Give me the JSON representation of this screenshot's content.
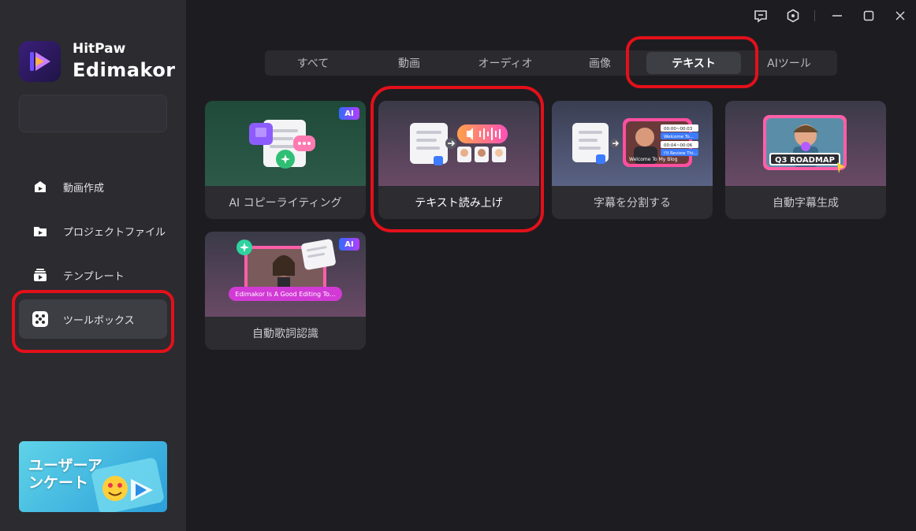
{
  "brand": {
    "line1": "HitPaw",
    "line2": "Edimakor"
  },
  "sidebar": {
    "items": [
      {
        "label": "動画作成",
        "icon": "create-video-icon"
      },
      {
        "label": "プロジェクトファイル",
        "icon": "project-folder-icon"
      },
      {
        "label": "テンプレート",
        "icon": "template-icon"
      },
      {
        "label": "ツールボックス",
        "icon": "toolbox-icon",
        "active": true
      }
    ],
    "promo": {
      "line1": "ユーザーア",
      "line2": "ンケート"
    }
  },
  "titlebar": {
    "icons": [
      "feedback-icon",
      "settings-icon",
      "minimize-icon",
      "maximize-icon",
      "close-icon"
    ]
  },
  "tabs": [
    {
      "label": "すべて"
    },
    {
      "label": "動画"
    },
    {
      "label": "オーディオ"
    },
    {
      "label": "画像"
    },
    {
      "label": "テキスト",
      "active": true
    },
    {
      "label": "AIツール"
    }
  ],
  "cards": [
    {
      "label": "AI コピーライティング",
      "ai": "AI",
      "thumb": "ai-copywriting"
    },
    {
      "label": "テキスト読み上げ",
      "thumb": "text-to-speech"
    },
    {
      "label": "字幕を分割する",
      "thumb": "split-subtitles",
      "overlay_times": [
        "00:00~00:03",
        "Welcome To...",
        "00:04~00:06",
        "I'll Review Thi..."
      ],
      "overlay_caption": "Welcome To My Blog"
    },
    {
      "label": "自動字幕生成",
      "thumb": "auto-subtitles",
      "overlay_caption": "Q3 ROADMAP"
    },
    {
      "label": "自動歌詞認識",
      "ai": "AI",
      "thumb": "auto-lyrics",
      "overlay_caption": "Edimakor Is A Good Editing To..."
    }
  ],
  "colors": {
    "accent_red": "#e3101a",
    "sidebar_bg": "#2b2b30",
    "main_bg": "#1d1d21"
  }
}
